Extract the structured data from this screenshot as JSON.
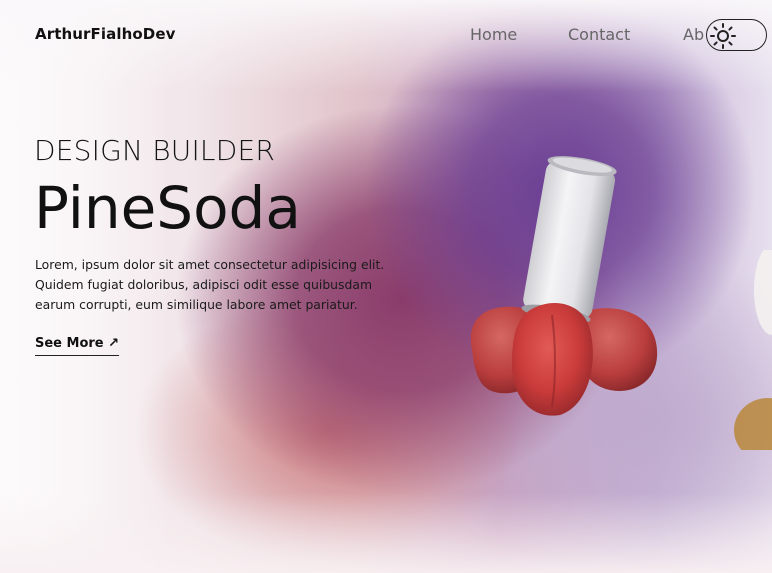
{
  "header": {
    "logo": "ArthurFialhoDev",
    "nav": [
      {
        "label": "Home"
      },
      {
        "label": "Contact"
      },
      {
        "label": "Ab"
      }
    ],
    "theme_toggle_icon": "sun-icon"
  },
  "hero": {
    "subtitle": "DESIGN BUILDER",
    "title": "PineSoda",
    "description": "Lorem, ipsum dolor sit amet consectetur adipisicing elit. Quidem fugiat doloribus, adipisci odit esse quibusdam earum corrupti, eum similique labore amet pariatur.",
    "cta_label": "See More",
    "cta_icon": "↗"
  },
  "colors": {
    "purple": "#6a3e93",
    "magenta": "#8a3c6a",
    "peach_red": "#c9403f",
    "can_silver": "#e9e9ea"
  }
}
